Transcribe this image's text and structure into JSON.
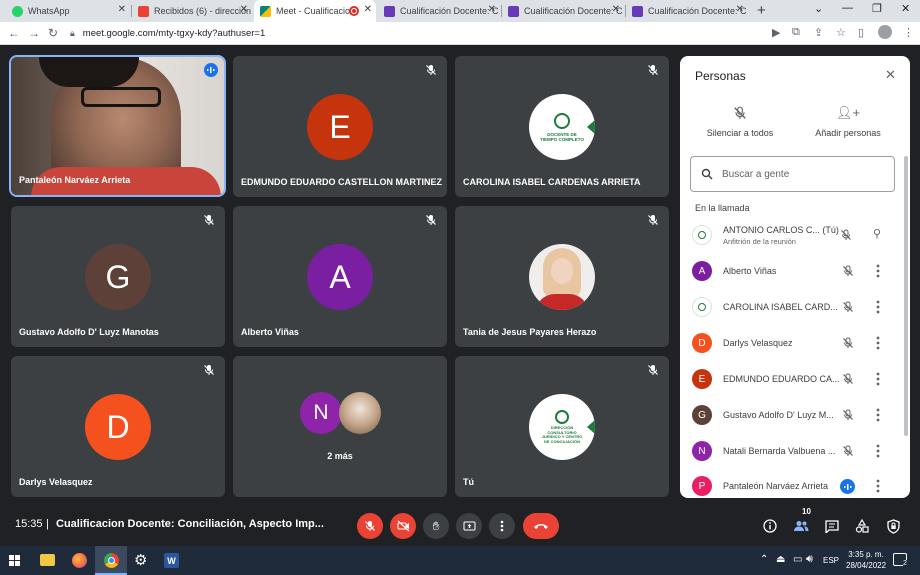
{
  "browser": {
    "tabs": [
      {
        "title": "WhatsApp",
        "favicon_color": "#25d366"
      },
      {
        "title": "Recibidos (6) - direccion",
        "favicon_color": "#ea4335"
      },
      {
        "title": "Meet - Cualificacion",
        "favicon_color": "#00897b"
      },
      {
        "title": "Cualificación Docente: C",
        "favicon_color": "#673ab7"
      },
      {
        "title": "Cualificación Docente: C",
        "favicon_color": "#673ab7"
      },
      {
        "title": "Cualificación Docente: C",
        "favicon_color": "#673ab7"
      }
    ],
    "new_tab": "+",
    "url": "meet.google.com/mty-tgxy-kdy?authuser=1"
  },
  "tiles": [
    {
      "name": "Pantaleón Narváez Arrieta",
      "kind": "video"
    },
    {
      "name": "EDMUNDO EDUARDO CASTELLON MARTINEZ",
      "kind": "avatar",
      "letter": "E",
      "color": "#c5340d"
    },
    {
      "name": "CAROLINA ISABEL CARDENAS ARRIETA",
      "kind": "logo",
      "logo_text": "DOCENTE DE TIEMPO COMPLETO"
    },
    {
      "name": "Gustavo Adolfo D' Luyz Manotas",
      "kind": "avatar",
      "letter": "G",
      "color": "#5d4037"
    },
    {
      "name": "Alberto Viñas",
      "kind": "avatar",
      "letter": "A",
      "color": "#7b1fa2"
    },
    {
      "name": "Tania de Jesus Payares Herazo",
      "kind": "photo"
    },
    {
      "name": "Darlys Velasquez",
      "kind": "avatar",
      "letter": "D",
      "color": "#f4511e"
    },
    {
      "name": "",
      "kind": "more",
      "letter": "N",
      "color": "#8e24aa",
      "more_label": "2 más"
    },
    {
      "name": "Tú",
      "kind": "logo",
      "logo_text": "DIRECCIÓN CONSULTORIO JURÍDICO Y CENTRO DE CONCILIACIÓN"
    }
  ],
  "bottom": {
    "time": "15:35",
    "meeting_title": "Cualificacion Docente: Conciliación, Aspecto Imp...",
    "people_count": "10"
  },
  "panel": {
    "title": "Personas",
    "mute_all": "Silenciar a todos",
    "add_people": "Añadir personas",
    "search_placeholder": "Buscar a gente",
    "section": "En la llamada",
    "people": [
      {
        "name": "ANTONIO CARLOS C...  (Tú)",
        "sub": "Anfitrión de la reunión",
        "letter": "",
        "color": "#ffffff",
        "logo": true
      },
      {
        "name": "Alberto Viñas",
        "letter": "A",
        "color": "#7b1fa2"
      },
      {
        "name": "CAROLINA ISABEL CARD...",
        "letter": "",
        "color": "#ffffff",
        "logo": true
      },
      {
        "name": "Darlys Velasquez",
        "letter": "D",
        "color": "#f4511e"
      },
      {
        "name": "EDMUNDO EDUARDO CA...",
        "letter": "E",
        "color": "#c5340d"
      },
      {
        "name": "Gustavo Adolfo D' Luyz M...",
        "letter": "G",
        "color": "#5d4037"
      },
      {
        "name": "Natali Bernarda Valbuena ...",
        "letter": "N",
        "color": "#8e24aa"
      },
      {
        "name": "Pantaleón Narváez Arrieta",
        "letter": "P",
        "color": "#e91e63"
      }
    ]
  },
  "taskbar": {
    "lang": "ESP",
    "clock_time": "3:35 p. m.",
    "clock_date": "28/04/2022",
    "notif_count": "2"
  }
}
